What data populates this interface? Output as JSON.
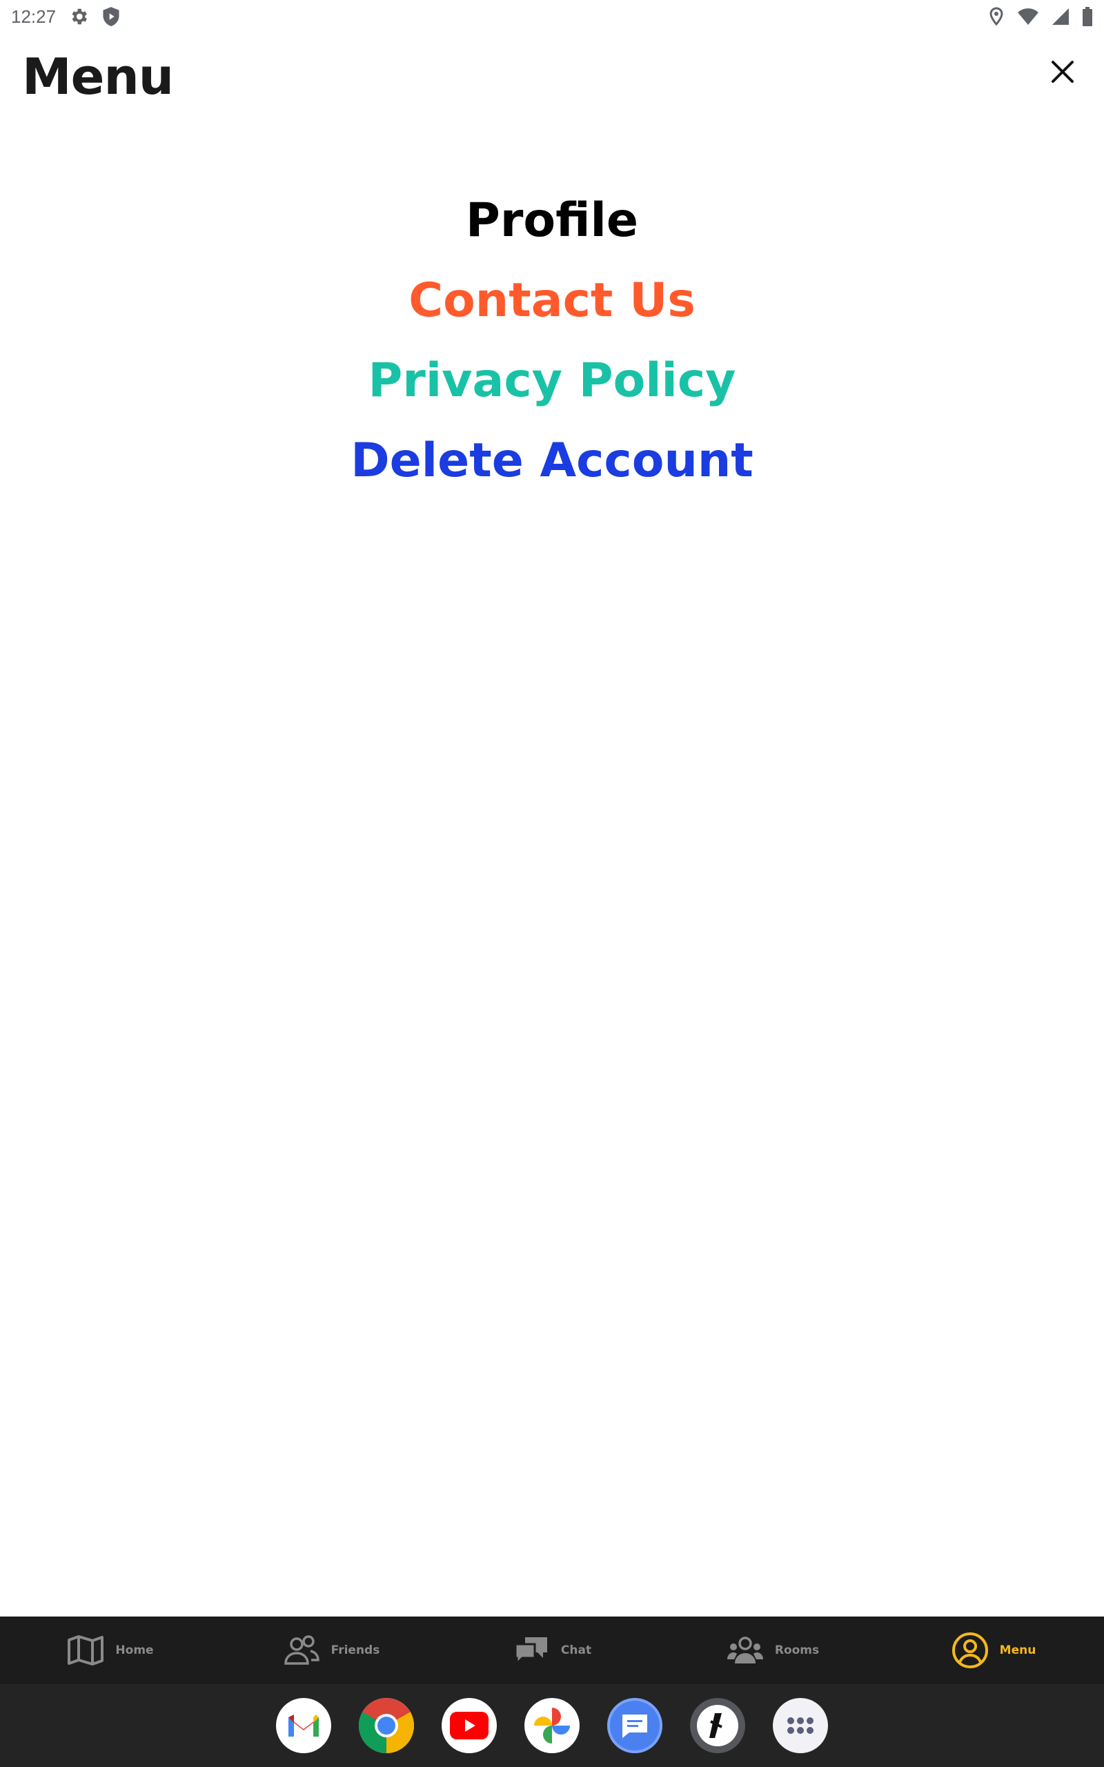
{
  "status_bar": {
    "time": "12:27",
    "left_icons": [
      "gear-icon",
      "shield-icon"
    ],
    "right_icons": [
      "location-pin-icon",
      "wifi-icon",
      "signal-icon",
      "battery-icon"
    ]
  },
  "header": {
    "title": "Menu",
    "close_icon": "close-icon"
  },
  "menu": {
    "items": [
      {
        "label": "Profile",
        "color": "#000000"
      },
      {
        "label": "Contact Us",
        "color": "#ff5a2c"
      },
      {
        "label": "Privacy Policy",
        "color": "#19c2a6"
      },
      {
        "label": "Delete Account",
        "color": "#1a3ce0"
      }
    ]
  },
  "bottom_nav": {
    "active_color": "#f5b81c",
    "inactive_color": "#8a8a8a",
    "items": [
      {
        "label": "Home",
        "icon": "map-icon",
        "active": false
      },
      {
        "label": "Friends",
        "icon": "friends-icon",
        "active": false
      },
      {
        "label": "Chat",
        "icon": "chat-icon",
        "active": false
      },
      {
        "label": "Rooms",
        "icon": "rooms-icon",
        "active": false
      },
      {
        "label": "Menu",
        "icon": "user-circle-icon",
        "active": true
      }
    ]
  },
  "dock": {
    "apps": [
      "gmail-icon",
      "chrome-icon",
      "youtube-icon",
      "photos-icon",
      "messages-icon",
      "app-icon",
      "app-drawer-icon"
    ]
  }
}
